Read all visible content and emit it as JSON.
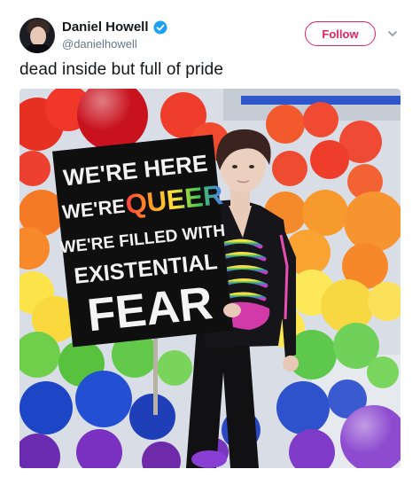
{
  "author": {
    "name": "Daniel Howell",
    "handle": "@danielhowell",
    "verified_icon": "verified-badge-icon",
    "avatar_icon": "user-avatar"
  },
  "follow_button": {
    "label": "Follow"
  },
  "menu": {
    "icon": "chevron-down-icon"
  },
  "tweet": {
    "text": "dead inside but full of pride"
  },
  "photo": {
    "sign": {
      "line1": "WE'RE HERE",
      "line2_prefix": "WE'RE",
      "line2_word": "QUEER",
      "line3": "WE'RE FILLED WITH",
      "line4": "EXISTENTIAL",
      "line5": "FEAR"
    }
  },
  "colors": {
    "follow": "#e0245e",
    "verified": "#1da1f2",
    "handle": "#657786",
    "text": "#14171a"
  }
}
